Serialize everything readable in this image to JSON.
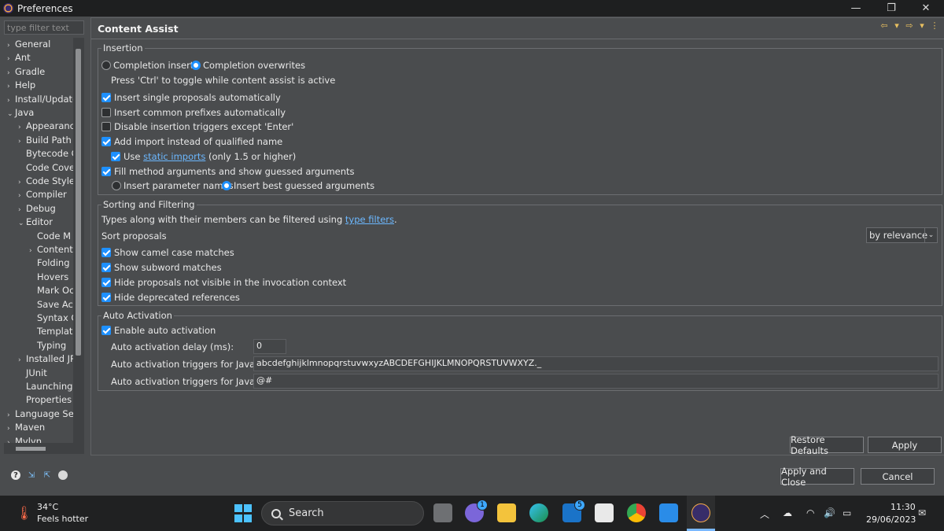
{
  "window": {
    "title": "Preferences",
    "controls": {
      "minimize": "—",
      "restore": "❐",
      "close": "✕"
    }
  },
  "sidebar": {
    "filter_placeholder": "type filter text",
    "items": [
      {
        "label": "General",
        "level": 0,
        "arrow": "›"
      },
      {
        "label": "Ant",
        "level": 0,
        "arrow": "›"
      },
      {
        "label": "Gradle",
        "level": 0,
        "arrow": "›"
      },
      {
        "label": "Help",
        "level": 0,
        "arrow": "›"
      },
      {
        "label": "Install/Update",
        "level": 0,
        "arrow": "›"
      },
      {
        "label": "Java",
        "level": 0,
        "arrow": "⌄"
      },
      {
        "label": "Appearance",
        "level": 1,
        "arrow": "›"
      },
      {
        "label": "Build Path",
        "level": 1,
        "arrow": "›"
      },
      {
        "label": "Bytecode C",
        "level": 1,
        "arrow": ""
      },
      {
        "label": "Code Cove",
        "level": 1,
        "arrow": ""
      },
      {
        "label": "Code Style",
        "level": 1,
        "arrow": "›"
      },
      {
        "label": "Compiler",
        "level": 1,
        "arrow": "›"
      },
      {
        "label": "Debug",
        "level": 1,
        "arrow": "›"
      },
      {
        "label": "Editor",
        "level": 1,
        "arrow": "⌄"
      },
      {
        "label": "Code M",
        "level": 2,
        "arrow": ""
      },
      {
        "label": "Content",
        "level": 2,
        "arrow": "›"
      },
      {
        "label": "Folding",
        "level": 2,
        "arrow": ""
      },
      {
        "label": "Hovers",
        "level": 2,
        "arrow": ""
      },
      {
        "label": "Mark Oc",
        "level": 2,
        "arrow": ""
      },
      {
        "label": "Save Ac",
        "level": 2,
        "arrow": ""
      },
      {
        "label": "Syntax C",
        "level": 2,
        "arrow": ""
      },
      {
        "label": "Templat",
        "level": 2,
        "arrow": ""
      },
      {
        "label": "Typing",
        "level": 2,
        "arrow": ""
      },
      {
        "label": "Installed JR",
        "level": 1,
        "arrow": "›"
      },
      {
        "label": "JUnit",
        "level": 1,
        "arrow": ""
      },
      {
        "label": "Launching",
        "level": 1,
        "arrow": ""
      },
      {
        "label": "Properties I",
        "level": 1,
        "arrow": ""
      },
      {
        "label": "Language Serv",
        "level": 0,
        "arrow": "›"
      },
      {
        "label": "Maven",
        "level": 0,
        "arrow": "›"
      },
      {
        "label": "Mylyn",
        "level": 0,
        "arrow": "›"
      }
    ]
  },
  "page": {
    "title": "Content Assist",
    "nav": [
      "⇦",
      "▾",
      "⇨",
      "▾",
      "⋮"
    ],
    "insertion": {
      "legend": "Insertion",
      "completion_inserts": "Completion inserts",
      "completion_overwrites": "Completion overwrites",
      "toggle_hint": "Press 'Ctrl' to toggle while content assist is active",
      "insert_single": "Insert single proposals automatically",
      "insert_common": "Insert common prefixes automatically",
      "disable_triggers": "Disable insertion triggers except 'Enter'",
      "add_import": "Add import instead of qualified name",
      "use_static_prefix": "Use ",
      "use_static_link": "static imports",
      "use_static_suffix": " (only 1.5 or higher)",
      "fill_args": "Fill method arguments and show guessed arguments",
      "insert_param_names": "Insert parameter names",
      "insert_best_guessed": "Insert best guessed arguments"
    },
    "sorting": {
      "legend": "Sorting and Filtering",
      "types_text_prefix": "Types along with their members can be filtered using ",
      "types_link": "type filters",
      "types_text_suffix": ".",
      "sort_label": "Sort proposals",
      "sort_value": "by relevance",
      "camel_case": "Show camel case matches",
      "subword": "Show subword matches",
      "hide_not_visible": "Hide proposals not visible in the invocation context",
      "hide_deprecated": "Hide deprecated references"
    },
    "auto": {
      "legend": "Auto Activation",
      "enable": "Enable auto activation",
      "delay_label": "Auto activation delay (ms):",
      "delay_value": "0",
      "java_label": "Auto activation triggers for Java:",
      "java_value": "abcdefghijklmnopqrstuvwxyzABCDEFGHIJKLMNOPQRSTUVWXYZ._",
      "javadoc_label": "Auto activation triggers for Javadoc:",
      "javadoc_value": "@#"
    },
    "buttons": {
      "restore_defaults": "Restore Defaults",
      "apply": "Apply",
      "apply_close": "Apply and Close",
      "cancel": "Cancel"
    }
  },
  "taskbar": {
    "weather_temp": "34°C",
    "weather_desc": "Feels hotter",
    "search_label": "Search",
    "teams_badge": "1",
    "mail_badge": "5",
    "time": "11:30",
    "date": "29/06/2023"
  }
}
